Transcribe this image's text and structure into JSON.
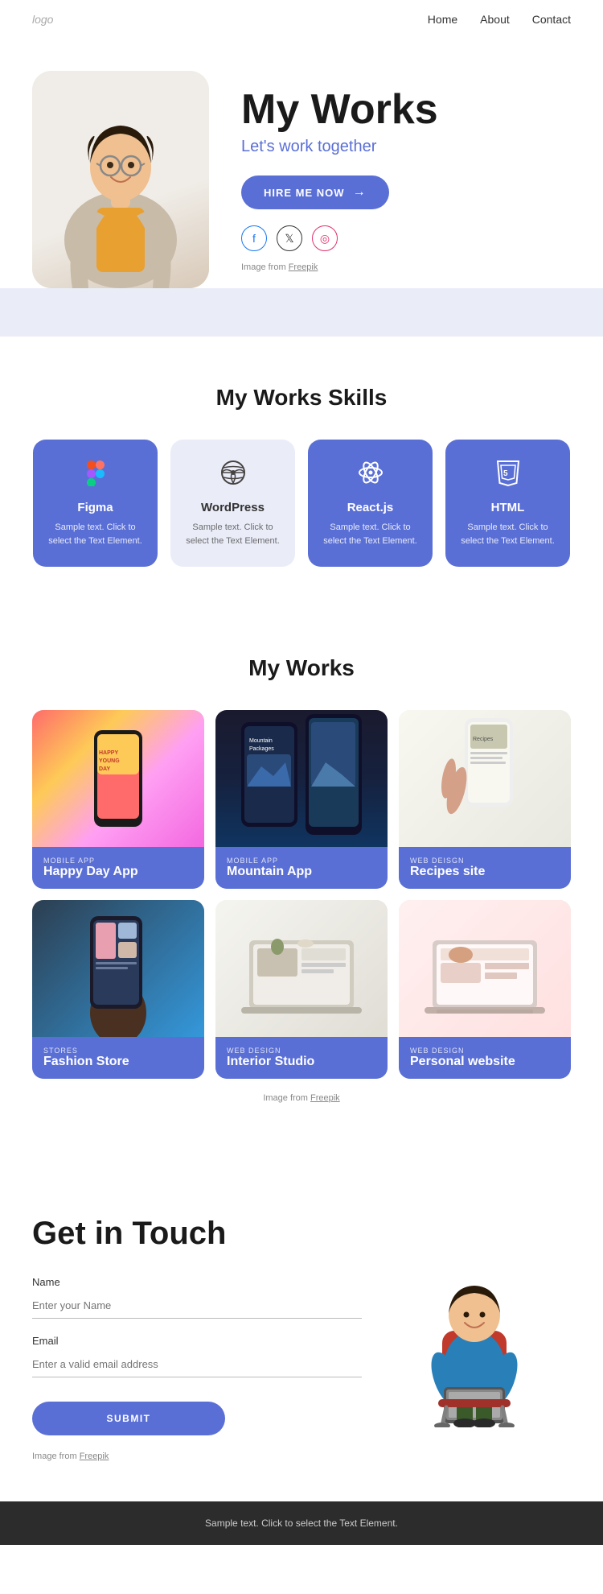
{
  "nav": {
    "logo": "logo",
    "links": [
      {
        "label": "Home",
        "href": "#"
      },
      {
        "label": "About",
        "href": "#"
      },
      {
        "label": "Contact",
        "href": "#"
      }
    ]
  },
  "hero": {
    "title": "My Works",
    "subtitle": "Let's work together",
    "cta": "HIRE ME NOW",
    "social": [
      {
        "name": "Facebook",
        "icon": "f"
      },
      {
        "name": "Twitter",
        "icon": "𝕏"
      },
      {
        "name": "Instagram",
        "icon": "◎"
      }
    ],
    "image_credit": "Image from ",
    "image_credit_link": "Freepik"
  },
  "skills": {
    "section_title": "My Works Skills",
    "items": [
      {
        "name": "Figma",
        "icon": "figma",
        "desc": "Sample text. Click to select the Text Element.",
        "variant": "dark"
      },
      {
        "name": "WordPress",
        "icon": "wordpress",
        "desc": "Sample text. Click to select the Text Element.",
        "variant": "light"
      },
      {
        "name": "React.js",
        "icon": "react",
        "desc": "Sample text. Click to select the Text Element.",
        "variant": "dark"
      },
      {
        "name": "HTML",
        "icon": "html",
        "desc": "Sample text. Click to select the Text Element.",
        "variant": "dark"
      }
    ]
  },
  "works": {
    "section_title": "My Works",
    "items": [
      {
        "category": "MOBILE APP",
        "name": "Happy Day App",
        "img_class": "img-happy-day",
        "overlay": "purple"
      },
      {
        "category": "MOBILE APP",
        "name": "Mountain App",
        "img_class": "img-mountain",
        "overlay": "purple"
      },
      {
        "category": "WEB DEISGN",
        "name": "Recipes site",
        "img_class": "img-recipes",
        "overlay": "purple"
      },
      {
        "category": "STORES",
        "name": "Fashion Store",
        "img_class": "img-fashion",
        "overlay": "purple"
      },
      {
        "category": "WEB DESIGN",
        "name": "Interior Studio",
        "img_class": "img-interior",
        "overlay": "purple"
      },
      {
        "category": "WEB DESIGN",
        "name": "Personal website",
        "img_class": "img-personal",
        "overlay": "purple"
      }
    ],
    "image_credit": "Image from ",
    "image_credit_link": "Freepik"
  },
  "contact": {
    "title": "Get in Touch",
    "fields": [
      {
        "label": "Name",
        "placeholder": "Enter your Name",
        "type": "text"
      },
      {
        "label": "Email",
        "placeholder": "Enter a valid email address",
        "type": "email"
      }
    ],
    "submit_label": "SUBMIT",
    "image_credit": "Image from ",
    "image_credit_link": "Freepik"
  },
  "footer": {
    "text": "Sample text. Click to select the Text Element."
  }
}
